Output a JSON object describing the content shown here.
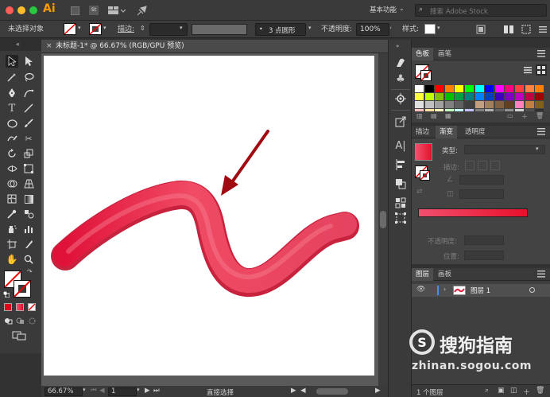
{
  "app": {
    "logo": "Ai",
    "workspace": "基本功能",
    "search_placeholder": "搜索 Adobe Stock"
  },
  "control_bar": {
    "selection_label": "未选择对象",
    "stroke_label": "描边:",
    "brush_label": "3 点圆形",
    "opacity_label": "不透明度:",
    "opacity_value": "100%",
    "style_label": "样式:"
  },
  "document": {
    "tab_title": "未标题-1* @ 66.67% (RGB/GPU 预览)",
    "zoom": "66.67%",
    "page": "1",
    "status_tool": "直接选择"
  },
  "swatches_panel": {
    "tabs": [
      "色板",
      "画笔"
    ],
    "colors": [
      "#ffffff",
      "#000000",
      "#ff0000",
      "#ff7f00",
      "#ffff00",
      "#00ff00",
      "#00ffff",
      "#0000ff",
      "#ff00ff",
      "#ff0080",
      "#ff4040",
      "#ff8040",
      "#ff8000",
      "#ffff40",
      "#c0ff00",
      "#80c000",
      "#00c000",
      "#00a040",
      "#008080",
      "#0080ff",
      "#0040c0",
      "#4000c0",
      "#8000c0",
      "#c000c0",
      "#c00040",
      "#a00000",
      "#e0e0e0",
      "#c0c0c0",
      "#a0a0a0",
      "#808080",
      "#606060",
      "#404040",
      "#c0a080",
      "#a08060",
      "#806040",
      "#604020",
      "#ff80c0",
      "#c08040",
      "#806020",
      "#ffc0c0",
      "#ffe0a0",
      "#ffffc0",
      "#c0ffc0",
      "#c0ffff",
      "#c0c0ff",
      "#808080",
      "#b0b0b0",
      "#606060",
      "#909090",
      "#d0d0d0",
      "#505050",
      "#303030"
    ]
  },
  "gradient_panel": {
    "tabs": [
      "描边",
      "渐变",
      "透明度"
    ],
    "type_label": "类型:",
    "stroke_label": "描边:",
    "opacity_label": "不透明度:",
    "position_label": "位置:",
    "gradient_start": "#f0506e",
    "gradient_end": "#e8102a"
  },
  "layers_panel": {
    "tabs": [
      "图层",
      "画板"
    ],
    "layer_name": "图层 1",
    "footer": "1 个图层"
  },
  "watermark": {
    "brand": "搜狗指南",
    "url": "zhinan.sogou.com"
  },
  "colors": {
    "stroke_dark": "#c0172e",
    "stroke_light": "#f2586f",
    "arrow": "#a20a12",
    "accent": "#ff9a00"
  }
}
